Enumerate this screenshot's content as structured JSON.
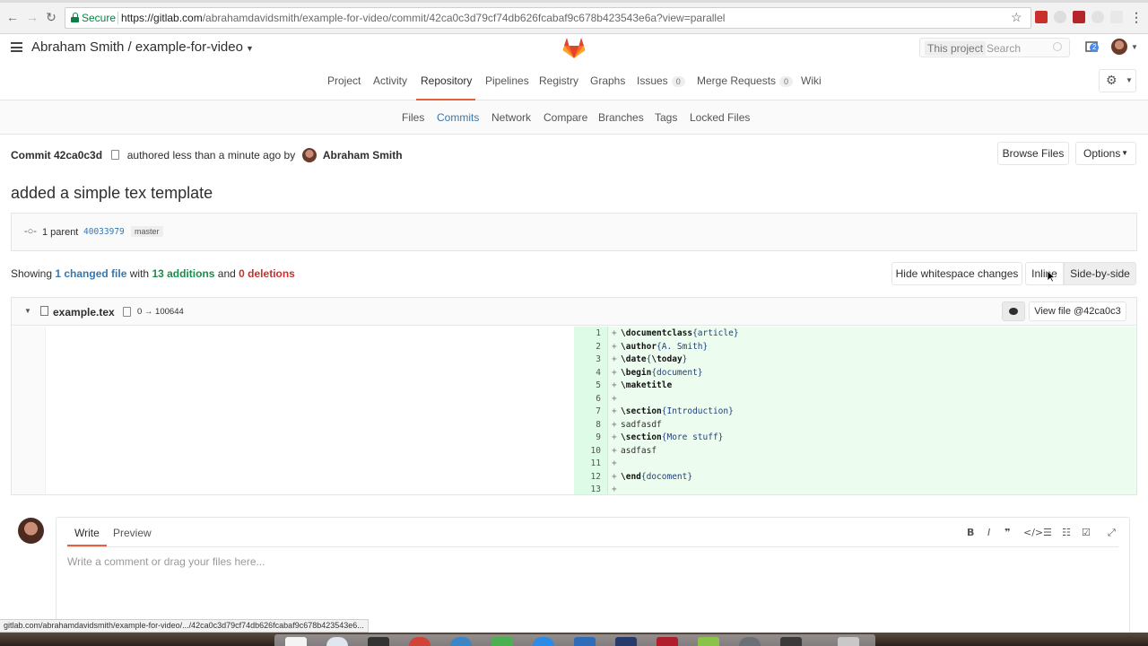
{
  "browser": {
    "security_label": "Secure",
    "url_host": "https://gitlab.com",
    "url_rest": "/abrahamdavidsmith/example-for-video/commit/42ca0c3d79cf74db626fcabaf9c678b423543e6a?view=parallel",
    "status_url": "gitlab.com/abrahamdavidsmith/example-for-video/.../42ca0c3d79cf74db626fcabaf9c678b423543e6..."
  },
  "header": {
    "project_title": "Abraham Smith / example-for-video",
    "search_scope": "This project",
    "search_placeholder": "Search",
    "todo_count": "2"
  },
  "nav_primary": {
    "items": [
      {
        "label": "Project"
      },
      {
        "label": "Activity"
      },
      {
        "label": "Repository"
      },
      {
        "label": "Pipelines"
      },
      {
        "label": "Registry"
      },
      {
        "label": "Graphs"
      },
      {
        "label": "Issues",
        "count": "0"
      },
      {
        "label": "Merge Requests",
        "count": "0"
      },
      {
        "label": "Wiki"
      }
    ],
    "active": "Repository"
  },
  "nav_secondary": {
    "items": [
      "Files",
      "Commits",
      "Network",
      "Compare",
      "Branches",
      "Tags",
      "Locked Files"
    ],
    "active": "Commits"
  },
  "commit": {
    "label": "Commit 42ca0c3d",
    "authored_text": "authored less than a minute ago by",
    "author": "Abraham Smith",
    "browse_files": "Browse Files",
    "options": "Options",
    "title": "added a simple tex template",
    "parent_count_text": "1 parent",
    "parent_sha": "40033979",
    "branch": "master"
  },
  "summary": {
    "showing": "Showing",
    "changed": "1 changed file",
    "with": "with",
    "additions": "13 additions",
    "and": "and",
    "deletions": "0 deletions",
    "hide_whitespace": "Hide whitespace changes",
    "inline": "Inline",
    "side_by_side": "Side-by-side"
  },
  "file": {
    "name": "example.tex",
    "mode": "0 → 100644",
    "view_file": "View file @42ca0c3",
    "lines": [
      {
        "n": "1",
        "parts": [
          [
            "k",
            "\\documentclass"
          ],
          [
            "a",
            "{article}"
          ]
        ]
      },
      {
        "n": "2",
        "parts": [
          [
            "k",
            "\\author"
          ],
          [
            "a",
            "{A. Smith}"
          ]
        ]
      },
      {
        "n": "3",
        "parts": [
          [
            "k",
            "\\date"
          ],
          [
            "a",
            "{"
          ],
          [
            "k",
            "\\today"
          ],
          [
            "a",
            "}"
          ]
        ]
      },
      {
        "n": "4",
        "parts": [
          [
            "k",
            "\\begin"
          ],
          [
            "a",
            "{document}"
          ]
        ]
      },
      {
        "n": "5",
        "parts": [
          [
            "k",
            "\\maketitle"
          ]
        ]
      },
      {
        "n": "6",
        "parts": []
      },
      {
        "n": "7",
        "parts": [
          [
            "k",
            "\\section"
          ],
          [
            "a",
            "{Introduction}"
          ]
        ]
      },
      {
        "n": "8",
        "parts": [
          [
            "t",
            "sadfasdf"
          ]
        ]
      },
      {
        "n": "9",
        "parts": [
          [
            "k",
            "\\section"
          ],
          [
            "a",
            "{More stuff}"
          ]
        ]
      },
      {
        "n": "10",
        "parts": [
          [
            "t",
            "asdfasf"
          ]
        ]
      },
      {
        "n": "11",
        "parts": []
      },
      {
        "n": "12",
        "parts": [
          [
            "k",
            "\\end"
          ],
          [
            "a",
            "{docoment}"
          ]
        ]
      },
      {
        "n": "13",
        "parts": []
      }
    ]
  },
  "comment": {
    "write_tab": "Write",
    "preview_tab": "Preview",
    "placeholder": "Write a comment or drag your files here..."
  },
  "colors": {
    "accent": "#e75e40",
    "link": "#3777b0",
    "addition": "#168f48",
    "deletion": "#c9302c",
    "diff_added_bg": "#ecfdf0"
  }
}
